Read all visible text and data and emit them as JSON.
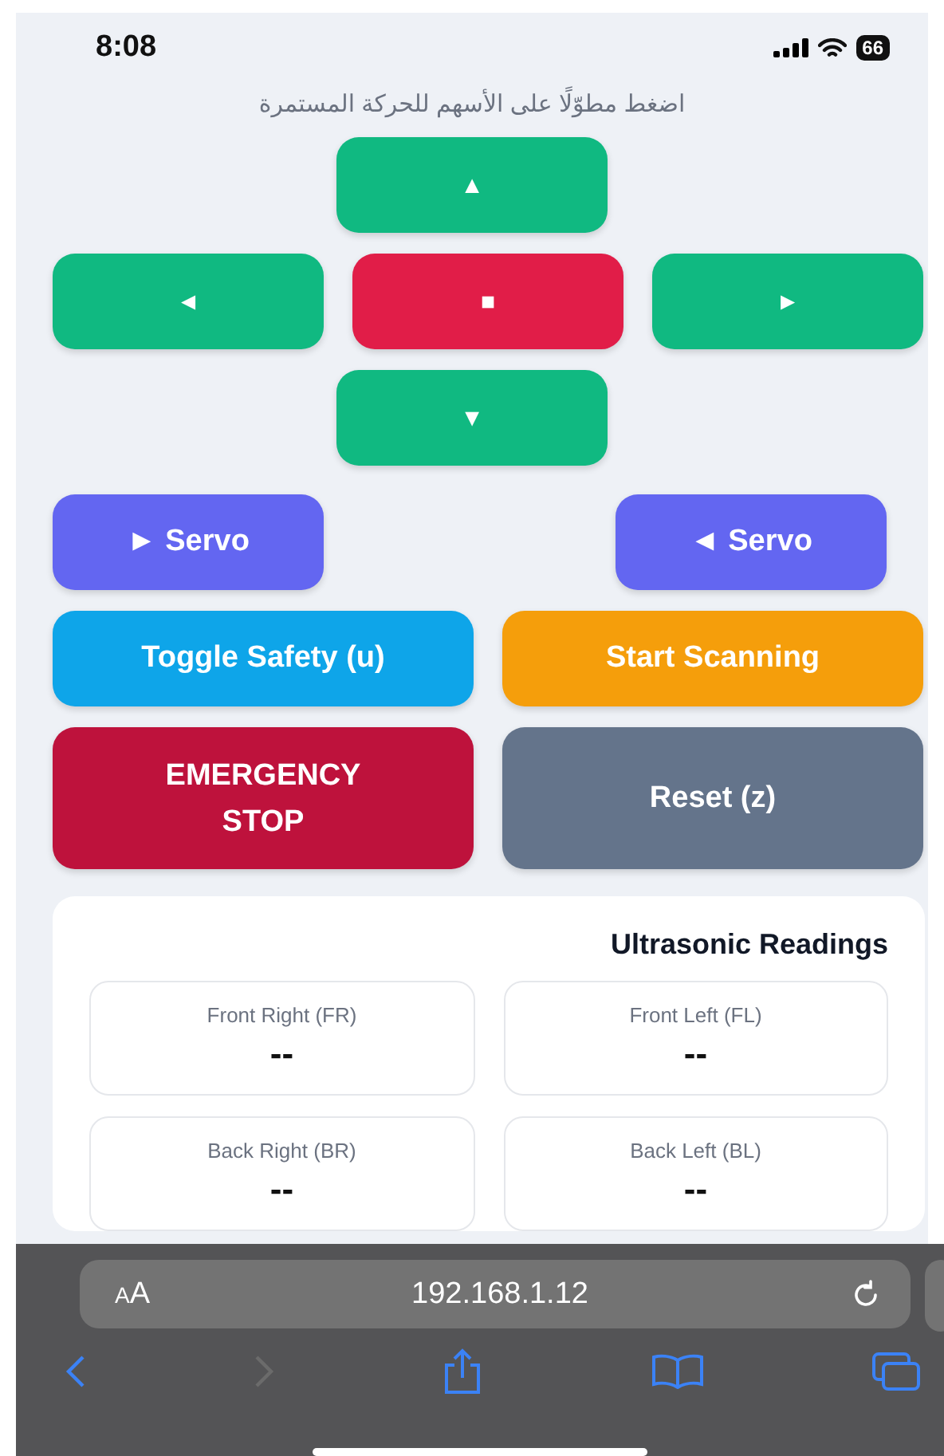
{
  "status_bar": {
    "time": "8:08",
    "battery": "66"
  },
  "hint": "اضغط مطوّلًا على الأسهم للحركة المستمرة",
  "dpad": {
    "up": {
      "label": "▲"
    },
    "left": {
      "label": "◄"
    },
    "stop": {
      "label": "■"
    },
    "right": {
      "label": "►"
    },
    "down": {
      "label": "▼"
    }
  },
  "servo": [
    {
      "label": "► Servo"
    },
    {
      "label": "◄ Servo"
    }
  ],
  "actions": [
    {
      "label": "Toggle Safety (u)",
      "kind": "safety"
    },
    {
      "label": "Start Scanning",
      "kind": "scan"
    },
    {
      "label": "EMERGENCY STOP",
      "kind": "emergency"
    },
    {
      "label": "Reset (z)",
      "kind": "reset"
    }
  ],
  "readings": {
    "title": "Ultrasonic Readings",
    "sensors": [
      {
        "label": "Front Right (FR)",
        "value": "--"
      },
      {
        "label": "Front Left (FL)",
        "value": "--"
      },
      {
        "label": "Back Right (BR)",
        "value": "--"
      },
      {
        "label": "Back Left (BL)",
        "value": "--"
      }
    ]
  },
  "browser": {
    "text_size": "AA",
    "url": "192.168.1.12",
    "back": {
      "disabled": false
    },
    "forward": {
      "disabled": true
    }
  }
}
